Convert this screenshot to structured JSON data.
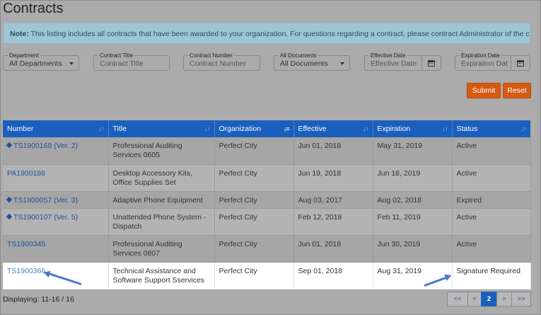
{
  "page": {
    "title": "Contracts",
    "note_label": "Note:",
    "note_text": " This listing includes all contracts that have been awarded to your organization. For questions regarding a contract, please contract Administrator of the contract."
  },
  "filters": {
    "department": {
      "label": "Department",
      "value": "All Departments"
    },
    "contract_title": {
      "label": "Contract Title",
      "placeholder": "Contract Title"
    },
    "contract_number": {
      "label": "Contract Number",
      "placeholder": "Contract Number"
    },
    "all_documents": {
      "label": "All Documents",
      "value": "All Documents"
    },
    "effective_date": {
      "label": "Effective Date",
      "placeholder": "Effective Date"
    },
    "expiration_date": {
      "label": "Expiration Date",
      "placeholder": "Expiration Date"
    }
  },
  "actions": {
    "submit": "Submit",
    "reset": "Reset"
  },
  "table": {
    "columns": [
      "Number",
      "Title",
      "Organization",
      "Effective",
      "Expiration",
      "Status"
    ],
    "rows": [
      {
        "number": "TS1900168 (Ver. 2)",
        "title": "Professional Auditing Services 0605",
        "organization": "Perfect City",
        "effective": "Jun 01, 2018",
        "expiration": "May 31, 2019",
        "status": "Active"
      },
      {
        "number": "PA1900186",
        "title": "Desktop Accessory Kits, Office Supplies Set",
        "organization": "Perfect City",
        "effective": "Jun 19, 2018",
        "expiration": "Jun 18, 2019",
        "status": "Active"
      },
      {
        "number": "TS1800057 (Ver. 3)",
        "title": "Adaptive Phone Equipment",
        "organization": "Perfect City",
        "effective": "Aug 03, 2017",
        "expiration": "Aug 02, 2018",
        "status": "Expired"
      },
      {
        "number": "TS1900107 (Ver. 5)",
        "title": "Unattended Phone System - Dispatch",
        "organization": "Perfect City",
        "effective": "Feb 12, 2018",
        "expiration": "Feb 11, 2019",
        "status": "Active"
      },
      {
        "number": "TS1900345",
        "title": "Professional Auditing Services 0807",
        "organization": "Perfect City",
        "effective": "Jun 01, 2018",
        "expiration": "Jun 30, 2019",
        "status": "Active"
      },
      {
        "number": "TS1900366",
        "title": "Technical Assistance and Software Support Sservices",
        "organization": "Perfect City",
        "effective": "Sep 01, 2018",
        "expiration": "Aug 31, 2019",
        "status": "Signature Required"
      }
    ]
  },
  "footer": {
    "displaying": "Displaying: 11-16 / 16"
  },
  "pager": {
    "first": "<<",
    "prev": "<",
    "current": "2",
    "next": ">",
    "last": ">>"
  },
  "colors": {
    "header": "#1b5fbd",
    "button": "#d65a12",
    "arrow": "#4b79c7"
  }
}
